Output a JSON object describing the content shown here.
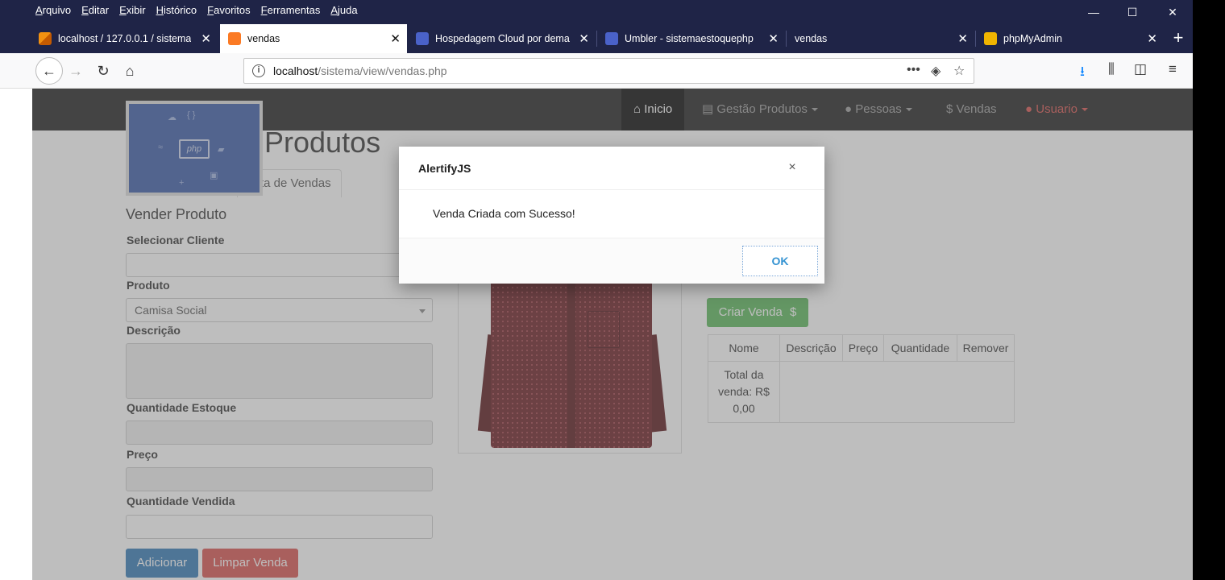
{
  "browser": {
    "menu": [
      "Arquivo",
      "Editar",
      "Exibir",
      "Histórico",
      "Favoritos",
      "Ferramentas",
      "Ajuda"
    ],
    "window_controls": {
      "minimize": "—",
      "maximize": "☐",
      "close": "✕"
    },
    "tabs": [
      {
        "title": "localhost / 127.0.0.1 / sistema",
        "icon": "phpmyadmin-sail-icon",
        "color": "#f29111"
      },
      {
        "title": "vendas",
        "icon": "xampp-icon",
        "color": "#fb7a24",
        "active": true
      },
      {
        "title": "Hospedagem Cloud por dema",
        "icon": "umbler-icon",
        "color": "#4a62c9"
      },
      {
        "title": "Umbler - sistemaestoquephp",
        "icon": "umbler-icon",
        "color": "#4a62c9"
      },
      {
        "title": "vendas",
        "icon": "none",
        "color": ""
      },
      {
        "title": "phpMyAdmin",
        "icon": "phpmyadmin-icon",
        "color": "#f0b400"
      }
    ],
    "new_tab": "+",
    "url": {
      "host": "localhost",
      "path": "/sistema/view/vendas.php"
    }
  },
  "site_nav": {
    "items": [
      {
        "label": "Inicio",
        "icon": "home-icon",
        "active": true
      },
      {
        "label": "Gestão Produtos",
        "icon": "list-icon",
        "dropdown": true
      },
      {
        "label": "Pessoas",
        "icon": "user-icon",
        "dropdown": true
      },
      {
        "label": "Vendas",
        "icon": "dollar-icon"
      },
      {
        "label": "Usuario",
        "icon": "user-icon",
        "dropdown": true,
        "color": "#d9534f"
      }
    ]
  },
  "logo": {
    "text": "php"
  },
  "page": {
    "title": "Produtos",
    "tab_label": "ta de Vendas",
    "form_heading": "Vender Produto",
    "labels": {
      "cliente": "Selecionar Cliente",
      "produto": "Produto",
      "descricao": "Descrição",
      "estoque": "Quantidade Estoque",
      "preco": "Preço",
      "vendida": "Quantidade Vendida"
    },
    "produto_selected": "Camisa Social",
    "buttons": {
      "adicionar": "Adicionar",
      "limpar": "Limpar Venda",
      "criar": "Criar Venda",
      "criar_icon": "$"
    },
    "table": {
      "headers": [
        "Nome",
        "Descrição",
        "Preço",
        "Quantidade",
        "Remover"
      ],
      "total": "Total da venda: R$ 0,00"
    }
  },
  "dialog": {
    "title": "AlertifyJS",
    "close": "×",
    "message": "Venda Criada com Sucesso!",
    "ok": "OK"
  },
  "colors": {
    "titlebar": "#1f2447",
    "primary": "#337ab7",
    "danger": "#d9534f",
    "success": "#5cb85c",
    "alertify_ok": "#3593d2"
  }
}
